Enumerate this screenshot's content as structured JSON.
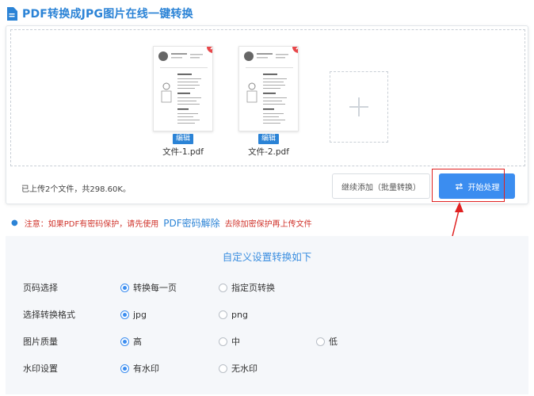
{
  "header": {
    "title": "PDF转换成JPG图片在线一键转换",
    "icon": "document-icon"
  },
  "files": [
    {
      "name": "文件-1.pdf",
      "edit_label": "编辑"
    },
    {
      "name": "文件-2.pdf",
      "edit_label": "编辑"
    }
  ],
  "status": {
    "text": "已上传2个文件，共298.60K。"
  },
  "buttons": {
    "continue_label": "继续添加（批量转换）",
    "start_label": "开始处理"
  },
  "notice": {
    "prefix": "注意：如果PDF有密码保护，请先使用",
    "link": "PDF密码解除",
    "suffix": "去除加密保护再上传文件"
  },
  "settings": {
    "title": "自定义设置转换如下",
    "rows": [
      {
        "label": "页码选择",
        "options": [
          "转换每一页",
          "指定页转换"
        ],
        "selected": 0
      },
      {
        "label": "选择转换格式",
        "options": [
          "jpg",
          "png"
        ],
        "selected": 0
      },
      {
        "label": "图片质量",
        "options": [
          "高",
          "中",
          "低"
        ],
        "selected": 0
      },
      {
        "label": "水印设置",
        "options": [
          "有水印",
          "无水印"
        ],
        "selected": 0
      }
    ]
  },
  "colors": {
    "accent": "#2b83d6",
    "button": "#3b8df0",
    "warning": "#d0342c",
    "remove": "#e8474a",
    "highlight": "#e02020"
  }
}
